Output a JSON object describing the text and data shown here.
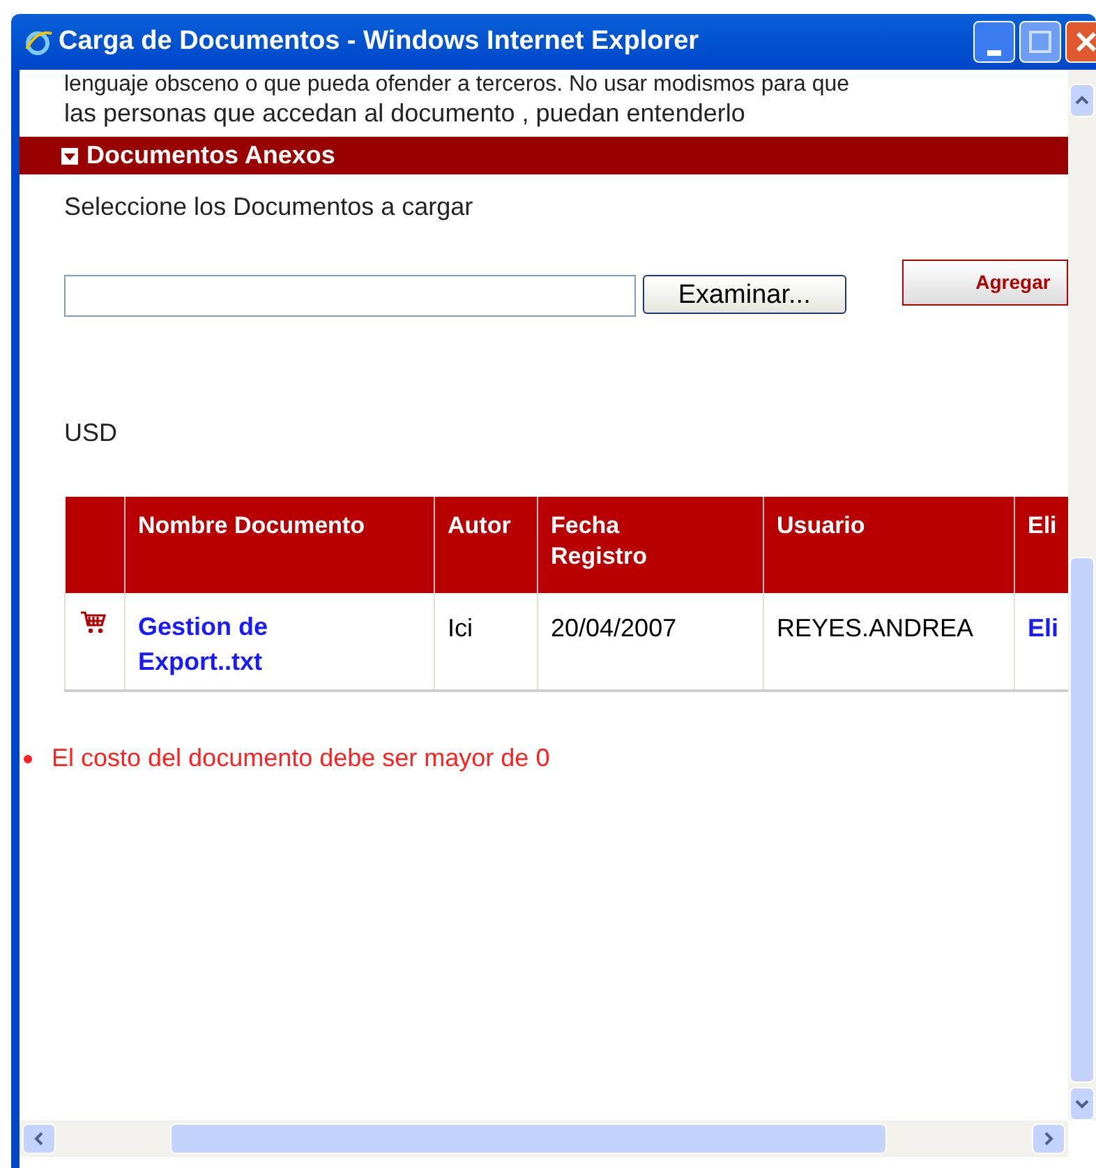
{
  "window": {
    "title": "Carga de Documentos - Windows Internet Explorer"
  },
  "intro": {
    "cut_line": "lenguaje obsceno o que pueda ofender a terceros.  No usar modismos para que",
    "line": "las personas que accedan al documento , puedan entenderlo"
  },
  "section": {
    "title": "Documentos Anexos",
    "expanded": true
  },
  "upload": {
    "label": "Seleccione los Documentos a cargar",
    "browse_button": "Examinar...",
    "add_button": "Agregar"
  },
  "currency": "USD",
  "table": {
    "columns": [
      "",
      "Nombre Documento",
      "Autor",
      "Fecha Registro",
      "Usuario",
      "Eli"
    ],
    "rows": [
      {
        "name": "Gestion de Export..txt",
        "author": "Ici",
        "date": "20/04/2007",
        "user": "REYES.ANDREA",
        "action": "Eli"
      }
    ]
  },
  "errors": [
    "El costo del documento debe ser mayor de 0"
  ]
}
